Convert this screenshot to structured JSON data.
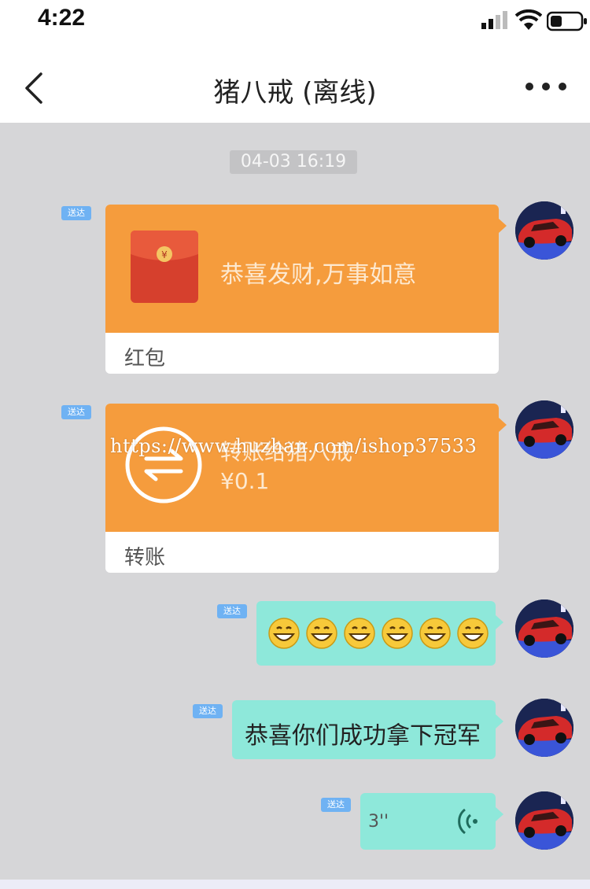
{
  "status_bar": {
    "time": "4:22"
  },
  "nav": {
    "title": "猪八戒 (离线)"
  },
  "chat": {
    "timestamp": "04-03 16:19",
    "messages": [
      {
        "type": "red_packet",
        "read_badge": "送达",
        "title": "恭喜发财,万事如意",
        "label": "红包"
      },
      {
        "type": "transfer",
        "read_badge": "送达",
        "title": "转账给猪八戒",
        "amount": "¥0.1",
        "label": "转账"
      },
      {
        "type": "emoji",
        "read_badge": "送达",
        "emojis": [
          "😄",
          "😄",
          "😄",
          "😄",
          "😄",
          "😄"
        ]
      },
      {
        "type": "text",
        "read_badge": "送达",
        "text": "恭喜你们成功拿下冠军"
      },
      {
        "type": "voice",
        "read_badge": "送达",
        "duration": "3''"
      }
    ]
  },
  "watermark": "https://www.huzhan.com/ishop37533",
  "icons": {
    "back": "chevron-left-icon",
    "more": "more-dots-icon",
    "red_packet": "red-packet-icon",
    "transfer": "transfer-icon",
    "voice": "voice-wave-icon"
  },
  "colors": {
    "card_orange": "#f59c3d",
    "bubble_teal": "#8ee8da",
    "chat_bg": "#d6d6d8",
    "badge_blue": "#6fb2f3"
  }
}
